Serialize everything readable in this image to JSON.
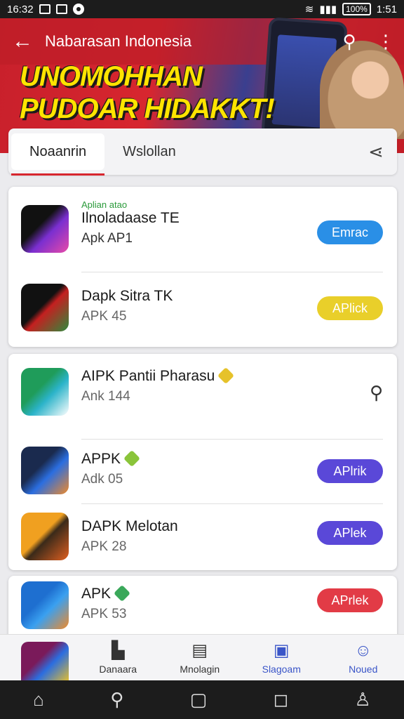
{
  "status_bar": {
    "time": "16:32",
    "right_time": "1:51",
    "battery": "100%"
  },
  "header": {
    "title": "Nabarasan Indonesia",
    "headline_line1": "UNOMOHHAN",
    "headline_line2": "PUDOAR HIDAKKT!",
    "back_icon": "back-arrow-icon",
    "search_icon": "search-icon",
    "menu_icon": "more-vert-icon"
  },
  "tabs": [
    {
      "label": "Noaanrin",
      "active": true
    },
    {
      "label": "Wslollan",
      "active": false
    }
  ],
  "apps_group1": [
    {
      "tag": "Aplian atao",
      "name": "Ilnoladaase TE",
      "sub": "Apk AP1",
      "button": "Emrac",
      "button_color": "#2a8fe6"
    },
    {
      "name": "Dapk Sitra TK",
      "sub": "APK 45",
      "button": "APlick",
      "button_color": "#e9cf2a"
    }
  ],
  "apps_group2": [
    {
      "name": "AIPK Pantii Pharasu",
      "sub": "Ank 144",
      "action_icon": "search-icon"
    },
    {
      "name": "APPK",
      "sub": "Adk 05",
      "button": "APlrik",
      "button_color": "#5a48d8"
    },
    {
      "name": "DAPK Melotan",
      "sub": "APK 28",
      "button": "APlek",
      "button_color": "#5a48d8"
    },
    {
      "name": "APK",
      "sub": "APK 53",
      "button": "APrlek",
      "button_color": "#e23b46"
    }
  ],
  "bottom_nav": [
    {
      "label": "Danaara",
      "icon": "library-icon"
    },
    {
      "label": "Mnolagin",
      "icon": "document-icon"
    },
    {
      "label": "Slagoam",
      "icon": "clipboard-icon"
    },
    {
      "label": "Noued",
      "icon": "person-icon"
    }
  ],
  "colors": {
    "brand_red": "#d7262f",
    "headline_yellow": "#ffe400",
    "nav_active": "#3a55c8"
  }
}
